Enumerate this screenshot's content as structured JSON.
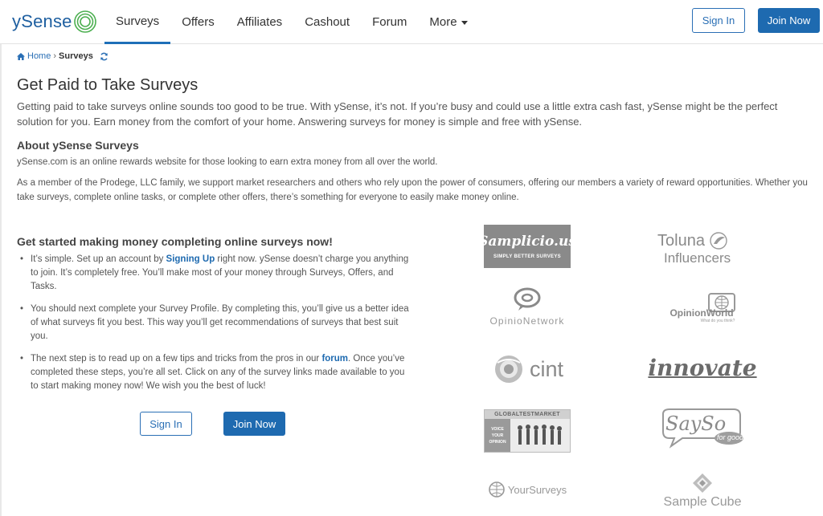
{
  "header": {
    "logo_text": "ySense",
    "nav": [
      {
        "label": "Surveys",
        "active": true
      },
      {
        "label": "Offers"
      },
      {
        "label": "Affiliates"
      },
      {
        "label": "Cashout"
      },
      {
        "label": "Forum"
      },
      {
        "label": "More"
      }
    ],
    "sign_in": "Sign In",
    "join_now": "Join Now",
    "accent_color": "#1e6ab0"
  },
  "breadcrumb": {
    "home": "Home",
    "separator": "›",
    "current": "Surveys"
  },
  "page": {
    "title": "Get Paid to Take Surveys",
    "intro": "Getting paid to take surveys online sounds too good to be true. With ySense, it’s not. If you’re busy and could use a little extra cash fast, ySense might be the perfect solution for you. Earn money from the comfort of your home. Answering surveys for money is simple and free with ySense.",
    "about_title": "About ySense Surveys",
    "about_p1": "ySense.com is an online rewards website for those looking to earn extra money from all over the world.",
    "about_p2": "As a member of the Prodege, LLC family, we support market researchers and others who rely upon the power of consumers, offering our members a variety of reward opportunities. Whether you take surveys, complete online tasks, or complete other offers, there’s something for everyone to easily make money online.",
    "started_title": "Get started making money completing online surveys now!",
    "bullet1": {
      "before": "It’s simple. Set up an account by ",
      "link": "Signing Up",
      "after": " right now. ySense doesn’t charge you anything to join. It’s completely free. You’ll make most of your money through Surveys, Offers, and Tasks."
    },
    "bullet2": "You should next complete your Survey Profile. By completing this, you’ll give us a better idea of what surveys fit you best. This way you’ll get recommendations of surveys that best suit you.",
    "bullet3": {
      "before": "The next step is to read up on a few tips and tricks from the pros in our ",
      "link": "forum",
      "after": ". Once you’ve completed these steps, you’re all set. Click on any of the survey links made available to you to start making money now! We wish you the best of luck!"
    },
    "sign_in": "Sign In",
    "join_now": "Join Now"
  },
  "partners": {
    "samplicio_name": "Samplicio.us",
    "samplicio_tag": "SIMPLY BETTER SURVEYS",
    "toluna_line1": "Toluna",
    "toluna_line2": "Influencers",
    "opinionetwork": "OpinioNetwork",
    "opinionworld": "OpinionWorld",
    "opinionworld_tag": "What do you think?",
    "cint": "cint",
    "innovate": "innovate",
    "gtm_title": "GLOBALTESTMARKET",
    "gtm_tag1": "VOICE",
    "gtm_tag2": "YOUR",
    "gtm_tag3": "OPINION",
    "sayso": "SaySo",
    "sayso_tag": "for good",
    "yoursurveys": "YourSurveys",
    "samplecube": "Sample Cube"
  }
}
